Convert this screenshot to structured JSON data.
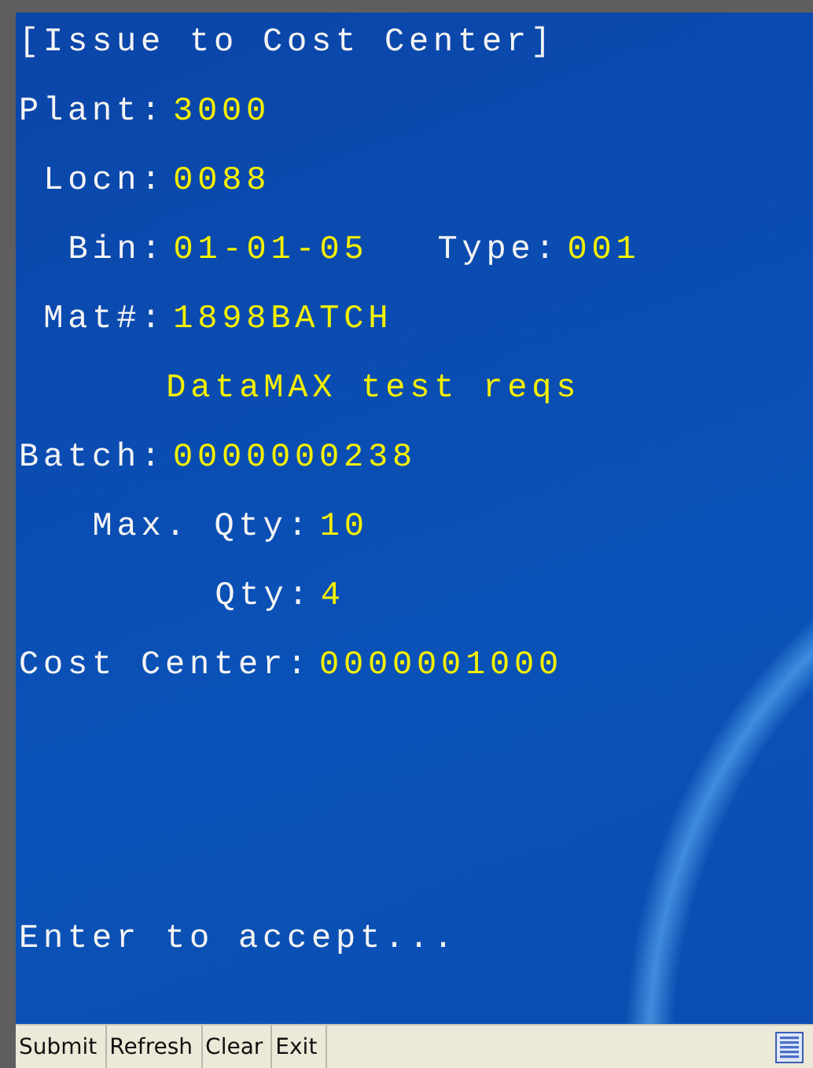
{
  "title": "[Issue to Cost Center]",
  "lines": [
    {
      "kind": "fields",
      "fields": [
        {
          "label": "Plant:",
          "value": "3000"
        }
      ]
    },
    {
      "kind": "fields",
      "fields": [
        {
          "label": "Locn:",
          "value": "0088"
        }
      ]
    },
    {
      "kind": "fields",
      "fields": [
        {
          "label": "Bin:",
          "value": "01-01-05"
        },
        {
          "label": "Type:",
          "value": "001"
        }
      ]
    },
    {
      "kind": "fields",
      "fields": [
        {
          "label": "Mat#:",
          "value": "1898BATCH"
        }
      ]
    },
    {
      "kind": "note",
      "text": "DataMAX test reqs"
    },
    {
      "kind": "fields",
      "fields": [
        {
          "label": "Batch:",
          "value": "0000000238"
        }
      ]
    },
    {
      "kind": "fields",
      "fields": [
        {
          "label": "Max. Qty:",
          "value": "10"
        }
      ]
    },
    {
      "kind": "fields",
      "fields": [
        {
          "label": "Qty:",
          "value": "4"
        }
      ]
    },
    {
      "kind": "fields",
      "fields": [
        {
          "label": "Cost Center:",
          "value": "0000001000"
        }
      ]
    }
  ],
  "message": "Enter to accept...",
  "menu": [
    "Submit",
    "Refresh",
    "Clear",
    "Exit"
  ]
}
